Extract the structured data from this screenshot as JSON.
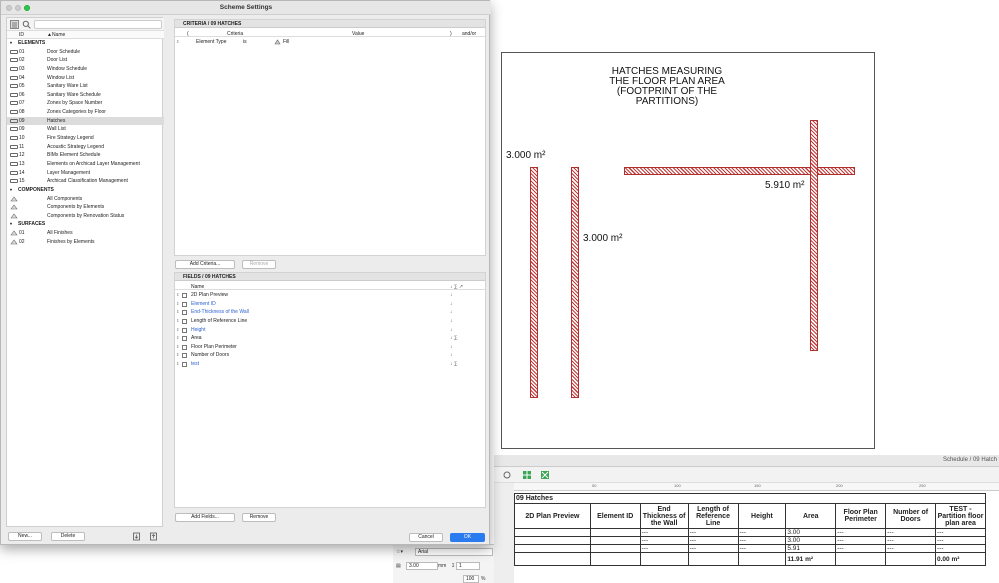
{
  "dialog": {
    "title": "Scheme Settings",
    "columns": {
      "id": "ID",
      "name": "▲Name"
    },
    "sections": [
      {
        "name": "ELEMENTS",
        "items": [
          {
            "id": "01",
            "name": "Door Schedule"
          },
          {
            "id": "02",
            "name": "Door List"
          },
          {
            "id": "03",
            "name": "Window Schedule"
          },
          {
            "id": "04",
            "name": "Window List"
          },
          {
            "id": "05",
            "name": "Sanitary Ware List"
          },
          {
            "id": "06",
            "name": "Sanitary Ware Schedule"
          },
          {
            "id": "07",
            "name": "Zones by Space Number"
          },
          {
            "id": "08",
            "name": "Zones Categories by Floor"
          },
          {
            "id": "09",
            "name": "Hatches"
          },
          {
            "id": "09",
            "name": "Wall List"
          },
          {
            "id": "10",
            "name": "Fire Strategy Legend"
          },
          {
            "id": "11",
            "name": "Acoustic Strategy Legend"
          },
          {
            "id": "12",
            "name": "BIMx Element Schedule"
          },
          {
            "id": "13",
            "name": "Elements on Archicad Layer Management"
          },
          {
            "id": "14",
            "name": "Layer Management"
          },
          {
            "id": "15",
            "name": "Archicad Classification Management"
          }
        ]
      },
      {
        "name": "COMPONENTS",
        "items": [
          {
            "id": "",
            "name": "All Components"
          },
          {
            "id": "",
            "name": "Components by Elements"
          },
          {
            "id": "",
            "name": "Components by Renovation Status"
          }
        ]
      },
      {
        "name": "SURFACES",
        "items": [
          {
            "id": "01",
            "name": "All Finishes"
          },
          {
            "id": "02",
            "name": "Finishes by Elements"
          }
        ]
      }
    ],
    "buttons": {
      "new": "New...",
      "delete": "Delete",
      "cancel": "Cancel",
      "ok": "OK"
    },
    "criteria": {
      "header": "CRITERIA / 09 HATCHES",
      "col_paren": "(",
      "col_criteria": "Criteria",
      "col_value": "Value",
      "col_close": ")",
      "col_andor": "and/or",
      "row": {
        "criteria": "Element Type",
        "op": "is",
        "value": "Fill"
      },
      "add_button": "Add Criteria...",
      "remove_button": "Remove"
    },
    "fields": {
      "header": "FIELDS / 09 HATCHES",
      "col_name": "Name",
      "items": [
        {
          "name": "2D Plan Preview",
          "sym": "↓",
          "blue": false
        },
        {
          "name": "Element ID",
          "sym": "↓",
          "blue": true
        },
        {
          "name": "End-Thickness of the Wall",
          "sym": "↓",
          "blue": true
        },
        {
          "name": "Length of Reference Line",
          "sym": "↓",
          "blue": false
        },
        {
          "name": "Height",
          "sym": "↓",
          "blue": true
        },
        {
          "name": "Area",
          "sym": "↓ ∑",
          "blue": false
        },
        {
          "name": "Floor Plan Perimeter",
          "sym": "↓",
          "blue": false
        },
        {
          "name": "Number of Doors",
          "sym": "↓",
          "blue": false
        },
        {
          "name": "test",
          "sym": "↓ ∑",
          "blue": true
        }
      ],
      "add_button": "Add Fields...",
      "remove_button": "Remove"
    }
  },
  "drawing": {
    "title_lines": [
      "HATCHES MEASURING",
      "THE FLOOR PLAN AREA",
      "(FOOTPRINT OF THE",
      "PARTITIONS)"
    ],
    "labels": [
      "3.000 m²",
      "3.000 m²",
      "5.910 m²"
    ]
  },
  "schedule_window": {
    "title": "Schedule / 09 Hatch",
    "ruler_ticks": [
      "50",
      "100",
      "150",
      "200",
      "250"
    ],
    "table": {
      "title": "09 Hatches",
      "headers": [
        "2D Plan Preview",
        "Element ID",
        "End Thickness of the Wall",
        "Length of Reference Line",
        "Height",
        "Area",
        "Floor Plan Perimeter",
        "Number of Doors",
        "TEST - Partition floor plan area"
      ],
      "rows": [
        [
          "",
          "",
          "---",
          "---",
          "---",
          "3.00",
          "---",
          "---",
          "---"
        ],
        [
          "",
          "",
          "---",
          "---",
          "---",
          "3.00",
          "---",
          "---",
          "---"
        ],
        [
          "",
          "",
          "---",
          "---",
          "---",
          "5.91",
          "---",
          "---",
          "---"
        ]
      ],
      "totals": [
        "",
        "",
        "",
        "",
        "",
        "11.91 m²",
        "",
        "",
        "0.00 m²"
      ]
    }
  },
  "props": {
    "font": "Arial",
    "size_value": "3.00",
    "size_unit": "mm",
    "line_value": "1",
    "zoom_value": "100",
    "zoom_unit": "%"
  },
  "colors": {
    "accent": "#2b7bf0",
    "hatch": "#c43a3a"
  }
}
